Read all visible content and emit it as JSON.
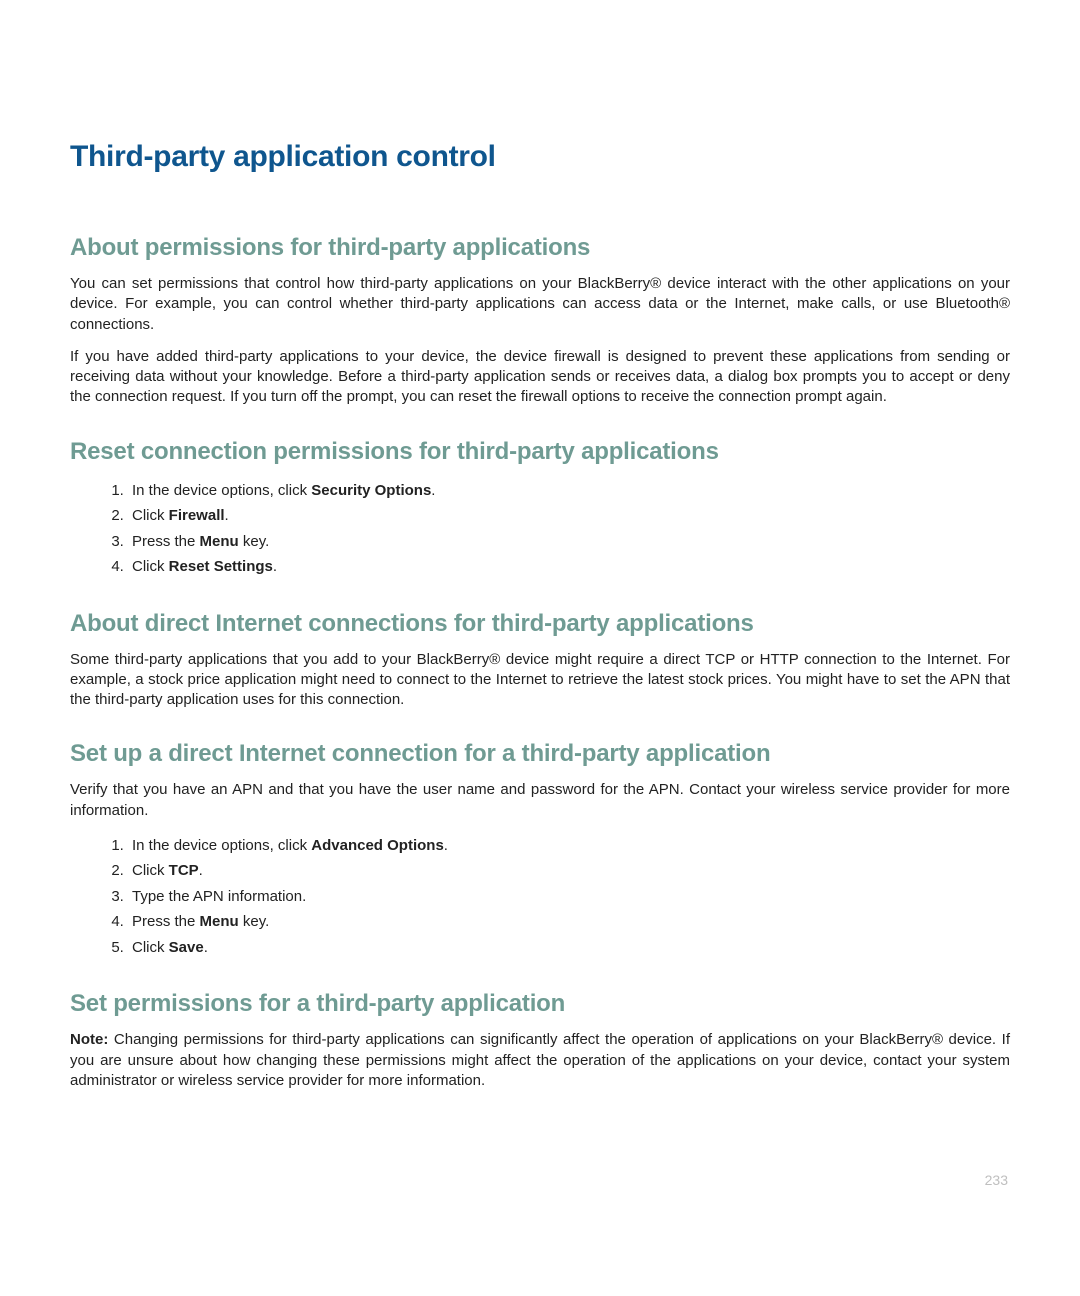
{
  "title": "Third-party application control",
  "section1": {
    "heading": "About permissions for third-party applications",
    "p1": "You can set permissions that control how third-party applications on your BlackBerry® device interact with the other applications on your device. For example, you can control whether third-party applications can access data or the Internet, make calls, or use Bluetooth® connections.",
    "p2": "If you have added third-party applications to your device, the device firewall is designed to prevent these applications from sending or receiving data without your knowledge. Before a third-party application sends or receives data, a dialog box prompts you to accept or deny the connection request. If you turn off the prompt, you can reset the firewall options to receive the connection prompt again."
  },
  "section2": {
    "heading": "Reset connection permissions for third-party applications",
    "steps": {
      "s1_pre": "In the device options, click ",
      "s1_b": "Security Options",
      "s1_post": ".",
      "s2_pre": "Click ",
      "s2_b": "Firewall",
      "s2_post": ".",
      "s3_pre": "Press the ",
      "s3_b": "Menu",
      "s3_post": " key.",
      "s4_pre": "Click ",
      "s4_b": "Reset Settings",
      "s4_post": "."
    }
  },
  "section3": {
    "heading": "About direct Internet connections for third-party applications",
    "p1": "Some third-party applications that you add to your BlackBerry® device might require a direct TCP or HTTP connection to the Internet. For example, a stock price application might need to connect to the Internet to retrieve the latest stock prices. You might have to set the APN that the third-party application uses for this connection."
  },
  "section4": {
    "heading": "Set up a direct Internet connection for a third-party application",
    "intro": "Verify that you have an APN and that you have the user name and password for the APN. Contact your wireless service provider for more information.",
    "steps": {
      "s1_pre": "In the device options, click ",
      "s1_b": "Advanced Options",
      "s1_post": ".",
      "s2_pre": "Click ",
      "s2_b": "TCP",
      "s2_post": ".",
      "s3": "Type the APN information.",
      "s4_pre": "Press the ",
      "s4_b": "Menu",
      "s4_post": " key.",
      "s5_pre": "Click ",
      "s5_b": "Save",
      "s5_post": "."
    }
  },
  "section5": {
    "heading": "Set permissions for a third-party application",
    "note_label": "Note:",
    "note_text": "  Changing permissions for third-party applications can significantly affect the operation of applications on your BlackBerry® device. If you are unsure about how changing these permissions might affect the operation of the applications on your device, contact your system administrator or wireless service provider for more information."
  },
  "page_number": "233"
}
